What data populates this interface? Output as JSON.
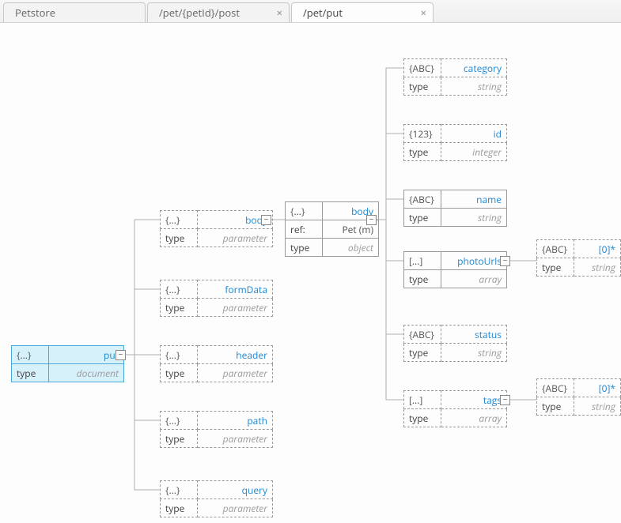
{
  "tabs": [
    {
      "label": "Petstore",
      "closable": false,
      "active": false
    },
    {
      "label": "/pet/{petId}/post",
      "closable": true,
      "active": false
    },
    {
      "label": "/pet/put",
      "closable": true,
      "active": true
    }
  ],
  "toggle_glyph": "−",
  "nodes": {
    "root": {
      "icon": "{...}",
      "title": "put",
      "rows": [
        [
          "type",
          "document"
        ]
      ],
      "style": "selected"
    },
    "p_body": {
      "icon": "{...}",
      "title": "body",
      "rows": [
        [
          "type",
          "parameter"
        ]
      ],
      "style": "dashed"
    },
    "p_formData": {
      "icon": "{...}",
      "title": "formData",
      "rows": [
        [
          "type",
          "parameter"
        ]
      ],
      "style": "dashed"
    },
    "p_header": {
      "icon": "{...}",
      "title": "header",
      "rows": [
        [
          "type",
          "parameter"
        ]
      ],
      "style": "dashed"
    },
    "p_path": {
      "icon": "{...}",
      "title": "path",
      "rows": [
        [
          "type",
          "parameter"
        ]
      ],
      "style": "dashed"
    },
    "p_query": {
      "icon": "{...}",
      "title": "query",
      "rows": [
        [
          "type",
          "parameter"
        ]
      ],
      "style": "dashed"
    },
    "body": {
      "icon": "{...}",
      "title": "body",
      "rows": [
        [
          "ref:",
          "Pet (m)"
        ],
        [
          "type",
          "object"
        ]
      ],
      "style": "solid"
    },
    "category": {
      "icon": "{ABC}",
      "title": "category",
      "rows": [
        [
          "type",
          "string"
        ]
      ],
      "style": "dashed"
    },
    "id": {
      "icon": "{123}",
      "title": "id",
      "rows": [
        [
          "type",
          "integer"
        ]
      ],
      "style": "dashed"
    },
    "name": {
      "icon": "{ABC}",
      "title": "name",
      "rows": [
        [
          "type",
          "string"
        ]
      ],
      "style": "solid"
    },
    "photoUrls": {
      "icon": "[...]",
      "title": "photoUrls",
      "rows": [
        [
          "type",
          "array"
        ]
      ],
      "style": "solid"
    },
    "status": {
      "icon": "{ABC}",
      "title": "status",
      "rows": [
        [
          "type",
          "string"
        ]
      ],
      "style": "dashed"
    },
    "tags": {
      "icon": "[...]",
      "title": "tags",
      "rows": [
        [
          "type",
          "array"
        ]
      ],
      "style": "dashed"
    },
    "photo_item": {
      "icon": "{ABC}",
      "title": "[0]*",
      "rows": [
        [
          "type",
          "string"
        ]
      ],
      "style": "dashed"
    },
    "tag_item": {
      "icon": "{ABC}",
      "title": "[0]*",
      "rows": [
        [
          "type",
          "string"
        ]
      ],
      "style": "dashed"
    }
  }
}
